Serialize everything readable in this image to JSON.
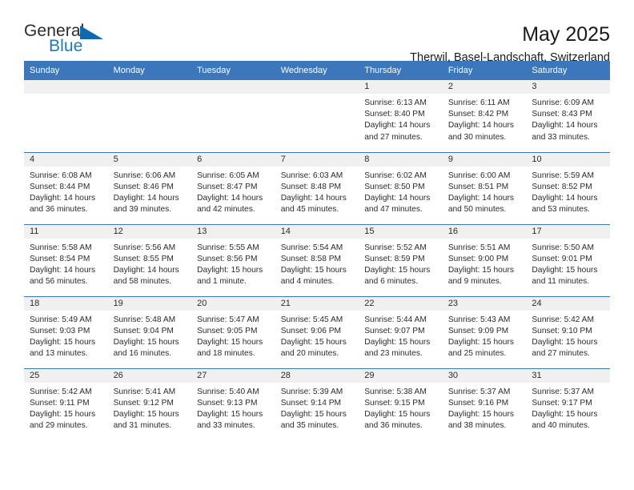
{
  "brand": {
    "name_part1": "General",
    "name_part2": "Blue",
    "accent_color": "#1169ad",
    "triangle_icon": "triangle-icon"
  },
  "header": {
    "title": "May 2025",
    "location": "Therwil, Basel-Landschaft, Switzerland"
  },
  "calendar": {
    "header_bg": "#3b77ba",
    "daynum_bg": "#f0f0f0",
    "weekdays": [
      "Sunday",
      "Monday",
      "Tuesday",
      "Wednesday",
      "Thursday",
      "Friday",
      "Saturday"
    ],
    "weeks": [
      [
        {
          "day": "",
          "empty": true,
          "sunrise": "",
          "sunset": "",
          "daylight1": "",
          "daylight2": ""
        },
        {
          "day": "",
          "empty": true,
          "sunrise": "",
          "sunset": "",
          "daylight1": "",
          "daylight2": ""
        },
        {
          "day": "",
          "empty": true,
          "sunrise": "",
          "sunset": "",
          "daylight1": "",
          "daylight2": ""
        },
        {
          "day": "",
          "empty": true,
          "sunrise": "",
          "sunset": "",
          "daylight1": "",
          "daylight2": ""
        },
        {
          "day": "1",
          "empty": false,
          "sunrise": "Sunrise: 6:13 AM",
          "sunset": "Sunset: 8:40 PM",
          "daylight1": "Daylight: 14 hours",
          "daylight2": "and 27 minutes."
        },
        {
          "day": "2",
          "empty": false,
          "sunrise": "Sunrise: 6:11 AM",
          "sunset": "Sunset: 8:42 PM",
          "daylight1": "Daylight: 14 hours",
          "daylight2": "and 30 minutes."
        },
        {
          "day": "3",
          "empty": false,
          "sunrise": "Sunrise: 6:09 AM",
          "sunset": "Sunset: 8:43 PM",
          "daylight1": "Daylight: 14 hours",
          "daylight2": "and 33 minutes."
        }
      ],
      [
        {
          "day": "4",
          "empty": false,
          "sunrise": "Sunrise: 6:08 AM",
          "sunset": "Sunset: 8:44 PM",
          "daylight1": "Daylight: 14 hours",
          "daylight2": "and 36 minutes."
        },
        {
          "day": "5",
          "empty": false,
          "sunrise": "Sunrise: 6:06 AM",
          "sunset": "Sunset: 8:46 PM",
          "daylight1": "Daylight: 14 hours",
          "daylight2": "and 39 minutes."
        },
        {
          "day": "6",
          "empty": false,
          "sunrise": "Sunrise: 6:05 AM",
          "sunset": "Sunset: 8:47 PM",
          "daylight1": "Daylight: 14 hours",
          "daylight2": "and 42 minutes."
        },
        {
          "day": "7",
          "empty": false,
          "sunrise": "Sunrise: 6:03 AM",
          "sunset": "Sunset: 8:48 PM",
          "daylight1": "Daylight: 14 hours",
          "daylight2": "and 45 minutes."
        },
        {
          "day": "8",
          "empty": false,
          "sunrise": "Sunrise: 6:02 AM",
          "sunset": "Sunset: 8:50 PM",
          "daylight1": "Daylight: 14 hours",
          "daylight2": "and 47 minutes."
        },
        {
          "day": "9",
          "empty": false,
          "sunrise": "Sunrise: 6:00 AM",
          "sunset": "Sunset: 8:51 PM",
          "daylight1": "Daylight: 14 hours",
          "daylight2": "and 50 minutes."
        },
        {
          "day": "10",
          "empty": false,
          "sunrise": "Sunrise: 5:59 AM",
          "sunset": "Sunset: 8:52 PM",
          "daylight1": "Daylight: 14 hours",
          "daylight2": "and 53 minutes."
        }
      ],
      [
        {
          "day": "11",
          "empty": false,
          "sunrise": "Sunrise: 5:58 AM",
          "sunset": "Sunset: 8:54 PM",
          "daylight1": "Daylight: 14 hours",
          "daylight2": "and 56 minutes."
        },
        {
          "day": "12",
          "empty": false,
          "sunrise": "Sunrise: 5:56 AM",
          "sunset": "Sunset: 8:55 PM",
          "daylight1": "Daylight: 14 hours",
          "daylight2": "and 58 minutes."
        },
        {
          "day": "13",
          "empty": false,
          "sunrise": "Sunrise: 5:55 AM",
          "sunset": "Sunset: 8:56 PM",
          "daylight1": "Daylight: 15 hours",
          "daylight2": "and 1 minute."
        },
        {
          "day": "14",
          "empty": false,
          "sunrise": "Sunrise: 5:54 AM",
          "sunset": "Sunset: 8:58 PM",
          "daylight1": "Daylight: 15 hours",
          "daylight2": "and 4 minutes."
        },
        {
          "day": "15",
          "empty": false,
          "sunrise": "Sunrise: 5:52 AM",
          "sunset": "Sunset: 8:59 PM",
          "daylight1": "Daylight: 15 hours",
          "daylight2": "and 6 minutes."
        },
        {
          "day": "16",
          "empty": false,
          "sunrise": "Sunrise: 5:51 AM",
          "sunset": "Sunset: 9:00 PM",
          "daylight1": "Daylight: 15 hours",
          "daylight2": "and 9 minutes."
        },
        {
          "day": "17",
          "empty": false,
          "sunrise": "Sunrise: 5:50 AM",
          "sunset": "Sunset: 9:01 PM",
          "daylight1": "Daylight: 15 hours",
          "daylight2": "and 11 minutes."
        }
      ],
      [
        {
          "day": "18",
          "empty": false,
          "sunrise": "Sunrise: 5:49 AM",
          "sunset": "Sunset: 9:03 PM",
          "daylight1": "Daylight: 15 hours",
          "daylight2": "and 13 minutes."
        },
        {
          "day": "19",
          "empty": false,
          "sunrise": "Sunrise: 5:48 AM",
          "sunset": "Sunset: 9:04 PM",
          "daylight1": "Daylight: 15 hours",
          "daylight2": "and 16 minutes."
        },
        {
          "day": "20",
          "empty": false,
          "sunrise": "Sunrise: 5:47 AM",
          "sunset": "Sunset: 9:05 PM",
          "daylight1": "Daylight: 15 hours",
          "daylight2": "and 18 minutes."
        },
        {
          "day": "21",
          "empty": false,
          "sunrise": "Sunrise: 5:45 AM",
          "sunset": "Sunset: 9:06 PM",
          "daylight1": "Daylight: 15 hours",
          "daylight2": "and 20 minutes."
        },
        {
          "day": "22",
          "empty": false,
          "sunrise": "Sunrise: 5:44 AM",
          "sunset": "Sunset: 9:07 PM",
          "daylight1": "Daylight: 15 hours",
          "daylight2": "and 23 minutes."
        },
        {
          "day": "23",
          "empty": false,
          "sunrise": "Sunrise: 5:43 AM",
          "sunset": "Sunset: 9:09 PM",
          "daylight1": "Daylight: 15 hours",
          "daylight2": "and 25 minutes."
        },
        {
          "day": "24",
          "empty": false,
          "sunrise": "Sunrise: 5:42 AM",
          "sunset": "Sunset: 9:10 PM",
          "daylight1": "Daylight: 15 hours",
          "daylight2": "and 27 minutes."
        }
      ],
      [
        {
          "day": "25",
          "empty": false,
          "sunrise": "Sunrise: 5:42 AM",
          "sunset": "Sunset: 9:11 PM",
          "daylight1": "Daylight: 15 hours",
          "daylight2": "and 29 minutes."
        },
        {
          "day": "26",
          "empty": false,
          "sunrise": "Sunrise: 5:41 AM",
          "sunset": "Sunset: 9:12 PM",
          "daylight1": "Daylight: 15 hours",
          "daylight2": "and 31 minutes."
        },
        {
          "day": "27",
          "empty": false,
          "sunrise": "Sunrise: 5:40 AM",
          "sunset": "Sunset: 9:13 PM",
          "daylight1": "Daylight: 15 hours",
          "daylight2": "and 33 minutes."
        },
        {
          "day": "28",
          "empty": false,
          "sunrise": "Sunrise: 5:39 AM",
          "sunset": "Sunset: 9:14 PM",
          "daylight1": "Daylight: 15 hours",
          "daylight2": "and 35 minutes."
        },
        {
          "day": "29",
          "empty": false,
          "sunrise": "Sunrise: 5:38 AM",
          "sunset": "Sunset: 9:15 PM",
          "daylight1": "Daylight: 15 hours",
          "daylight2": "and 36 minutes."
        },
        {
          "day": "30",
          "empty": false,
          "sunrise": "Sunrise: 5:37 AM",
          "sunset": "Sunset: 9:16 PM",
          "daylight1": "Daylight: 15 hours",
          "daylight2": "and 38 minutes."
        },
        {
          "day": "31",
          "empty": false,
          "sunrise": "Sunrise: 5:37 AM",
          "sunset": "Sunset: 9:17 PM",
          "daylight1": "Daylight: 15 hours",
          "daylight2": "and 40 minutes."
        }
      ]
    ]
  }
}
